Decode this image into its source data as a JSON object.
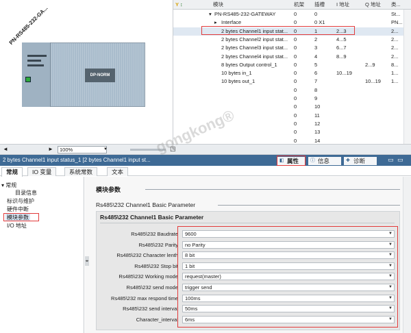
{
  "device": {
    "name": "PN-RS485-232-GA...",
    "module_label": "DP-NORM"
  },
  "table": {
    "columns": [
      "模块",
      "机架",
      "插槽",
      "I 地址",
      "Q 地址",
      "类..."
    ],
    "rows": [
      {
        "module": "PN-RS485-232-GATEWAY",
        "rack": "0",
        "slot": "0",
        "i_addr": "",
        "q_addr": "",
        "type": "St..."
      },
      {
        "module": "Interface",
        "rack": "0",
        "slot": "0 X1",
        "i_addr": "",
        "q_addr": "",
        "type": "PN..."
      },
      {
        "module": "2 bytes Channel1 input stat...",
        "rack": "0",
        "slot": "1",
        "i_addr": "2...3",
        "q_addr": "",
        "type": "2..."
      },
      {
        "module": "2 bytes Channel2 input stat...",
        "rack": "0",
        "slot": "2",
        "i_addr": "4...5",
        "q_addr": "",
        "type": "2..."
      },
      {
        "module": "2 bytes Channel3 input stat...",
        "rack": "0",
        "slot": "3",
        "i_addr": "6...7",
        "q_addr": "",
        "type": "2..."
      },
      {
        "module": "2 bytes Channel4 input stat...",
        "rack": "0",
        "slot": "4",
        "i_addr": "8...9",
        "q_addr": "",
        "type": "2..."
      },
      {
        "module": "8 bytes Output control_1",
        "rack": "0",
        "slot": "5",
        "i_addr": "",
        "q_addr": "2...9",
        "type": "8..."
      },
      {
        "module": "10 bytes in_1",
        "rack": "0",
        "slot": "6",
        "i_addr": "10...19",
        "q_addr": "",
        "type": "1..."
      },
      {
        "module": "10 bytes out_1",
        "rack": "0",
        "slot": "7",
        "i_addr": "",
        "q_addr": "10...19",
        "type": "1..."
      },
      {
        "module": "",
        "rack": "0",
        "slot": "8",
        "i_addr": "",
        "q_addr": "",
        "type": ""
      },
      {
        "module": "",
        "rack": "0",
        "slot": "9",
        "i_addr": "",
        "q_addr": "",
        "type": ""
      },
      {
        "module": "",
        "rack": "0",
        "slot": "10",
        "i_addr": "",
        "q_addr": "",
        "type": ""
      },
      {
        "module": "",
        "rack": "0",
        "slot": "11",
        "i_addr": "",
        "q_addr": "",
        "type": ""
      },
      {
        "module": "",
        "rack": "0",
        "slot": "12",
        "i_addr": "",
        "q_addr": "",
        "type": ""
      },
      {
        "module": "",
        "rack": "0",
        "slot": "13",
        "i_addr": "",
        "q_addr": "",
        "type": ""
      },
      {
        "module": "",
        "rack": "0",
        "slot": "14",
        "i_addr": "",
        "q_addr": "",
        "type": ""
      }
    ]
  },
  "toolbar": {
    "zoom": "100%"
  },
  "inspector": {
    "title": "2 bytes Channel1 input status_1 [2 bytes Channel1 input st...",
    "tabs": [
      "属性",
      "信息",
      "诊断"
    ],
    "sub_tabs": [
      "常规",
      "IO 变量",
      "系统常数",
      "文本"
    ]
  },
  "nav": {
    "root": "常规",
    "items": [
      "目录信息",
      "标识与维护",
      "硬件中断",
      "模块参数",
      "I/O 地址"
    ]
  },
  "content": {
    "section_title": "模块参数",
    "sub_heading": "Rs485\\232 Channel1 Basic Parameter",
    "panel_title": "Rs485\\232 Channel1 Basic Parameter",
    "params": [
      {
        "label": "Rs485\\232  Baudrate",
        "value": "9600"
      },
      {
        "label": "Rs485\\232  Parity",
        "value": "no Parity"
      },
      {
        "label": "Rs485\\232  Character lenth",
        "value": "8 bit"
      },
      {
        "label": "Rs485\\232 Stop bit",
        "value": "1 bit"
      },
      {
        "label": "Rs485\\232 Working mode",
        "value": "request(master)"
      },
      {
        "label": "Rs485\\232 send mode",
        "value": "trigger send"
      },
      {
        "label": "Rs485\\232 max respond time",
        "value": "100ms"
      },
      {
        "label": "Rs485\\232 send interval",
        "value": "50ms"
      },
      {
        "label": "Character_interval",
        "value": "6ms"
      }
    ]
  },
  "watermark": "gongkong®",
  "colors": {
    "highlight_red": "#e23a3a",
    "header_blue": "#3e6a95",
    "selection_row": "#dfe8f2"
  }
}
